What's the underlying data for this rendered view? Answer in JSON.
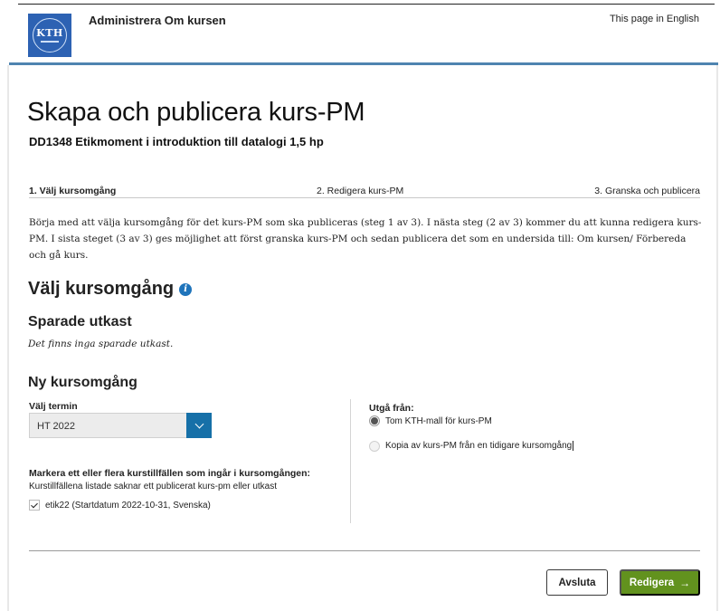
{
  "header": {
    "logo_text": "KTH",
    "app_title": "Administrera Om kursen",
    "language_link": "This page in English"
  },
  "page": {
    "title": "Skapa och publicera kurs-PM",
    "course": "DD1348 Etikmoment i introduktion till datalogi 1,5 hp"
  },
  "steps": [
    {
      "label": "1. Välj kursomgång",
      "active": true
    },
    {
      "label": "2. Redigera kurs-PM",
      "active": false
    },
    {
      "label": "3. Granska och publicera",
      "active": false
    }
  ],
  "intro_text": "Börja med att välja kursomgång för det kurs-PM som ska publiceras (steg 1 av 3). I nästa steg (2 av 3) kommer du att kunna redigera kurs-PM. I sista steget (3 av 3) ges möjlighet att först granska kurs-PM och sedan publicera det som en undersida till: Om kursen/ Förbereda och gå kurs.",
  "section": {
    "title": "Välj kursomgång",
    "info_icon_glyph": "i",
    "info_icon_color": "#1f74bb"
  },
  "drafts": {
    "title": "Sparade utkast",
    "empty_text": "Det finns inga sparade utkast."
  },
  "new_occasion": {
    "title": "Ny kursomgång",
    "term_label": "Välj termin",
    "term_value": "HT 2022",
    "mark_label": "Markera ett eller flera kurstillfällen som ingår i kursomgången:",
    "mark_hint": "Kurstillfällena listade saknar ett publicerat kurs-pm eller utkast",
    "occasions": [
      {
        "label": "etik22 (Startdatum 2022-10-31, Svenska)",
        "checked": true
      }
    ]
  },
  "base": {
    "label": "Utgå från:",
    "options": [
      {
        "label": "Tom KTH-mall för kurs-PM",
        "selected": true
      },
      {
        "label": "Kopia av kurs-PM från en tidigare kursomgång",
        "selected": false
      }
    ]
  },
  "actions": {
    "cancel_label": "Avsluta",
    "edit_label": "Redigera",
    "edit_arrow": "→"
  },
  "colors": {
    "accent_bar": "#4f84b0",
    "primary_button": "#62921e",
    "select_button": "#1670a8",
    "logo_bg": "#2d62b3"
  }
}
